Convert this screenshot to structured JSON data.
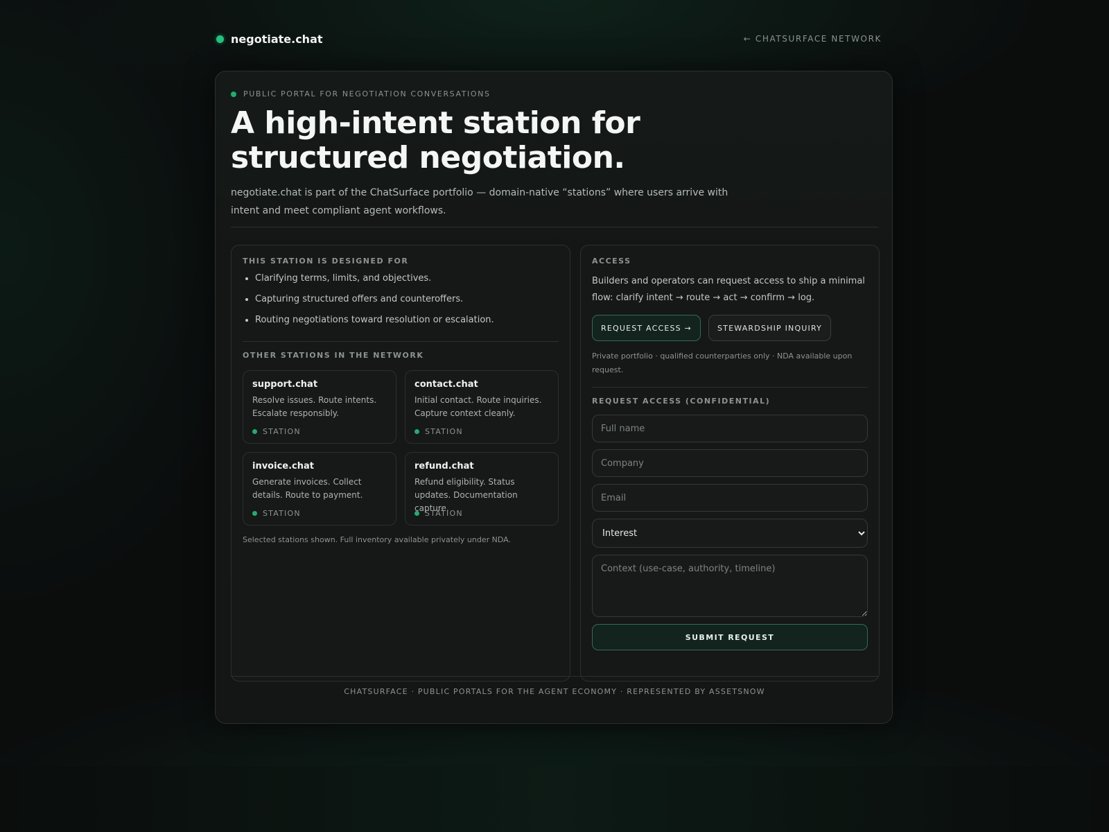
{
  "header": {
    "brand": "negotiate.chat",
    "back_link": "← CHATSURFACE NETWORK"
  },
  "hero": {
    "eyebrow": "PUBLIC PORTAL FOR NEGOTIATION CONVERSATIONS",
    "title": "A high-intent station for structured negotiation.",
    "description": "negotiate.chat is part of the ChatSurface portfolio — domain-native “stations” where users arrive with intent and meet compliant agent workflows."
  },
  "designed_for": {
    "label": "THIS STATION IS DESIGNED FOR",
    "items": [
      "Clarifying terms, limits, and objectives.",
      "Capturing structured offers and counteroffers.",
      "Routing negotiations toward resolution or escalation."
    ]
  },
  "network": {
    "label": "OTHER STATIONS IN THE NETWORK",
    "stations": [
      {
        "name": "support.chat",
        "description": "Resolve issues. Route intents. Escalate responsibly.",
        "tag": "STATION"
      },
      {
        "name": "contact.chat",
        "description": "Initial contact. Route inquiries. Capture context cleanly.",
        "tag": "STATION"
      },
      {
        "name": "invoice.chat",
        "description": "Generate invoices. Collect details. Route to payment.",
        "tag": "STATION"
      },
      {
        "name": "refund.chat",
        "description": "Refund eligibility. Status updates. Documentation capture.",
        "tag": "STATION"
      }
    ],
    "note": "Selected stations shown. Full inventory available privately under NDA."
  },
  "access": {
    "label": "ACCESS",
    "description": "Builders and operators can request access to ship a minimal flow: clarify intent → route → act → confirm → log.",
    "primary_button": "REQUEST ACCESS →",
    "secondary_button": "STEWARDSHIP INQUIRY",
    "fine_print": "Private portfolio · qualified counterparties only · NDA available upon request."
  },
  "form": {
    "label": "REQUEST ACCESS (CONFIDENTIAL)",
    "full_name_placeholder": "Full name",
    "company_placeholder": "Company",
    "email_placeholder": "Email",
    "interest_selected": "Interest",
    "context_placeholder": "Context (use-case, authority, timeline)",
    "submit_label": "SUBMIT REQUEST"
  },
  "footer": {
    "text": "CHATSURFACE · PUBLIC PORTALS FOR THE AGENT ECONOMY · REPRESENTED BY ASSETSNOW"
  },
  "colors": {
    "accent": "#21c27c",
    "background": "#0b0d0d",
    "card": "#141615",
    "primary_button_bg": "#13231d",
    "primary_button_border": "#2f6e55"
  },
  "icons": {
    "brand_status": "green-dot-icon",
    "back": "arrow-left-icon"
  }
}
